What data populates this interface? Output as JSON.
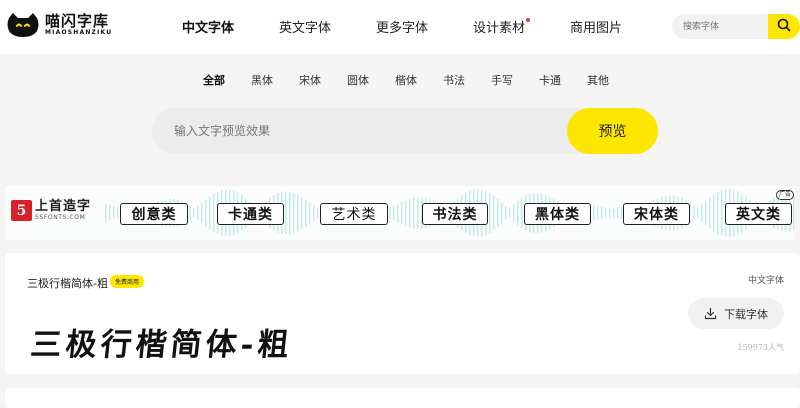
{
  "header": {
    "logo_name": "喵闪字库",
    "logo_sub": "MIAOSHANZIKU",
    "nav": [
      {
        "label": "中文字体",
        "active": true
      },
      {
        "label": "英文字体",
        "active": false
      },
      {
        "label": "更多字体",
        "active": false
      },
      {
        "label": "设计素材",
        "active": false,
        "dot": true
      },
      {
        "label": "商用图片",
        "active": false
      }
    ],
    "search_placeholder": "搜索字体"
  },
  "categories": [
    {
      "label": "全部",
      "active": true
    },
    {
      "label": "黑体"
    },
    {
      "label": "宋体"
    },
    {
      "label": "圆体"
    },
    {
      "label": "楷体"
    },
    {
      "label": "书法"
    },
    {
      "label": "手写"
    },
    {
      "label": "卡通"
    },
    {
      "label": "其他"
    }
  ],
  "preview": {
    "placeholder": "输入文字预览效果",
    "button_label": "预览"
  },
  "banner": {
    "brand_mark": "5",
    "brand_name": "上首造字",
    "brand_sub": "SSFONTS.COM",
    "tags": [
      "创意类",
      "卡通类",
      "艺术类",
      "书法类",
      "黑体类",
      "宋体类",
      "英文类"
    ],
    "ad_label": "广告"
  },
  "font_card": {
    "name": "三极行楷简体-粗",
    "badge": "免费商用",
    "category": "中文字体",
    "sample": "三极行楷简体-粗",
    "download_label": "下载字体",
    "popularity": "159973人气"
  },
  "colors": {
    "accent": "#fde700",
    "background": "#f4f4f4",
    "card": "#ffffff"
  }
}
